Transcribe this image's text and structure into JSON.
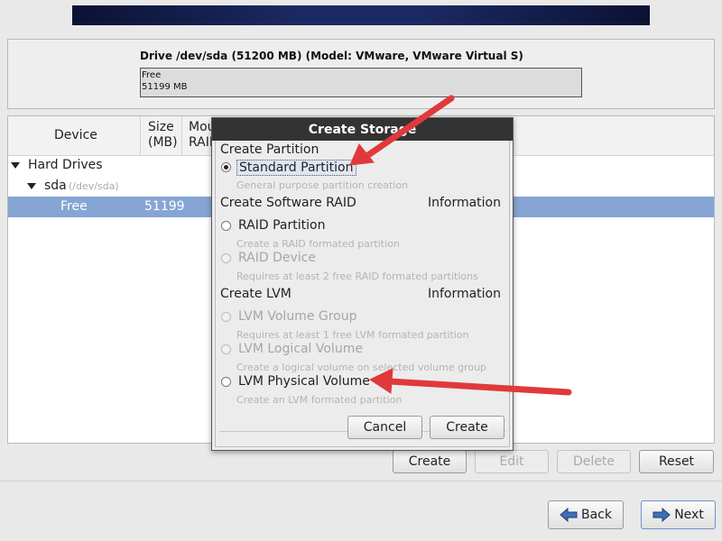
{
  "drive": {
    "title": "Drive /dev/sda (51200 MB) (Model: VMware, VMware Virtual S)",
    "segment_label": "Free",
    "segment_size": "51199 MB"
  },
  "tree": {
    "columns": {
      "device": "Device",
      "size_line1": "Size",
      "size_line2": "(MB)",
      "mount_line1": "Mou",
      "mount_line2": "RAID"
    },
    "rows": {
      "hard_drives": "Hard Drives",
      "sda": "sda",
      "sda_path": "(/dev/sda)",
      "free_device": "Free",
      "free_size": "51199"
    }
  },
  "actions": {
    "create": "Create",
    "edit": "Edit",
    "delete": "Delete",
    "reset": "Reset"
  },
  "nav": {
    "back": "Back",
    "next": "Next"
  },
  "dialog": {
    "title": "Create Storage",
    "sections": {
      "partition": "Create Partition",
      "raid": "Create Software RAID",
      "raid_info": "Information",
      "lvm": "Create LVM",
      "lvm_info": "Information"
    },
    "options": {
      "standard": {
        "label": "Standard Partition",
        "desc": "General purpose partition creation",
        "selected": true
      },
      "raid_partition": {
        "label": "RAID Partition",
        "desc": "Create a RAID formated partition"
      },
      "raid_device": {
        "label": "RAID Device",
        "desc": "Requires at least 2 free RAID formated partitions"
      },
      "lvm_vg": {
        "label": "LVM Volume Group",
        "desc": "Requires at least 1 free LVM formated partition"
      },
      "lvm_lv": {
        "label": "LVM Logical Volume",
        "desc": "Create a logical volume on selected volume group"
      },
      "lvm_pv": {
        "label": "LVM Physical Volume",
        "desc": "Create an LVM formated partition"
      }
    },
    "buttons": {
      "cancel": "Cancel",
      "create": "Create"
    }
  },
  "colors": {
    "selection": "#86a5d4",
    "annotation_arrow": "#e0393b",
    "title_bar": "#333333"
  }
}
